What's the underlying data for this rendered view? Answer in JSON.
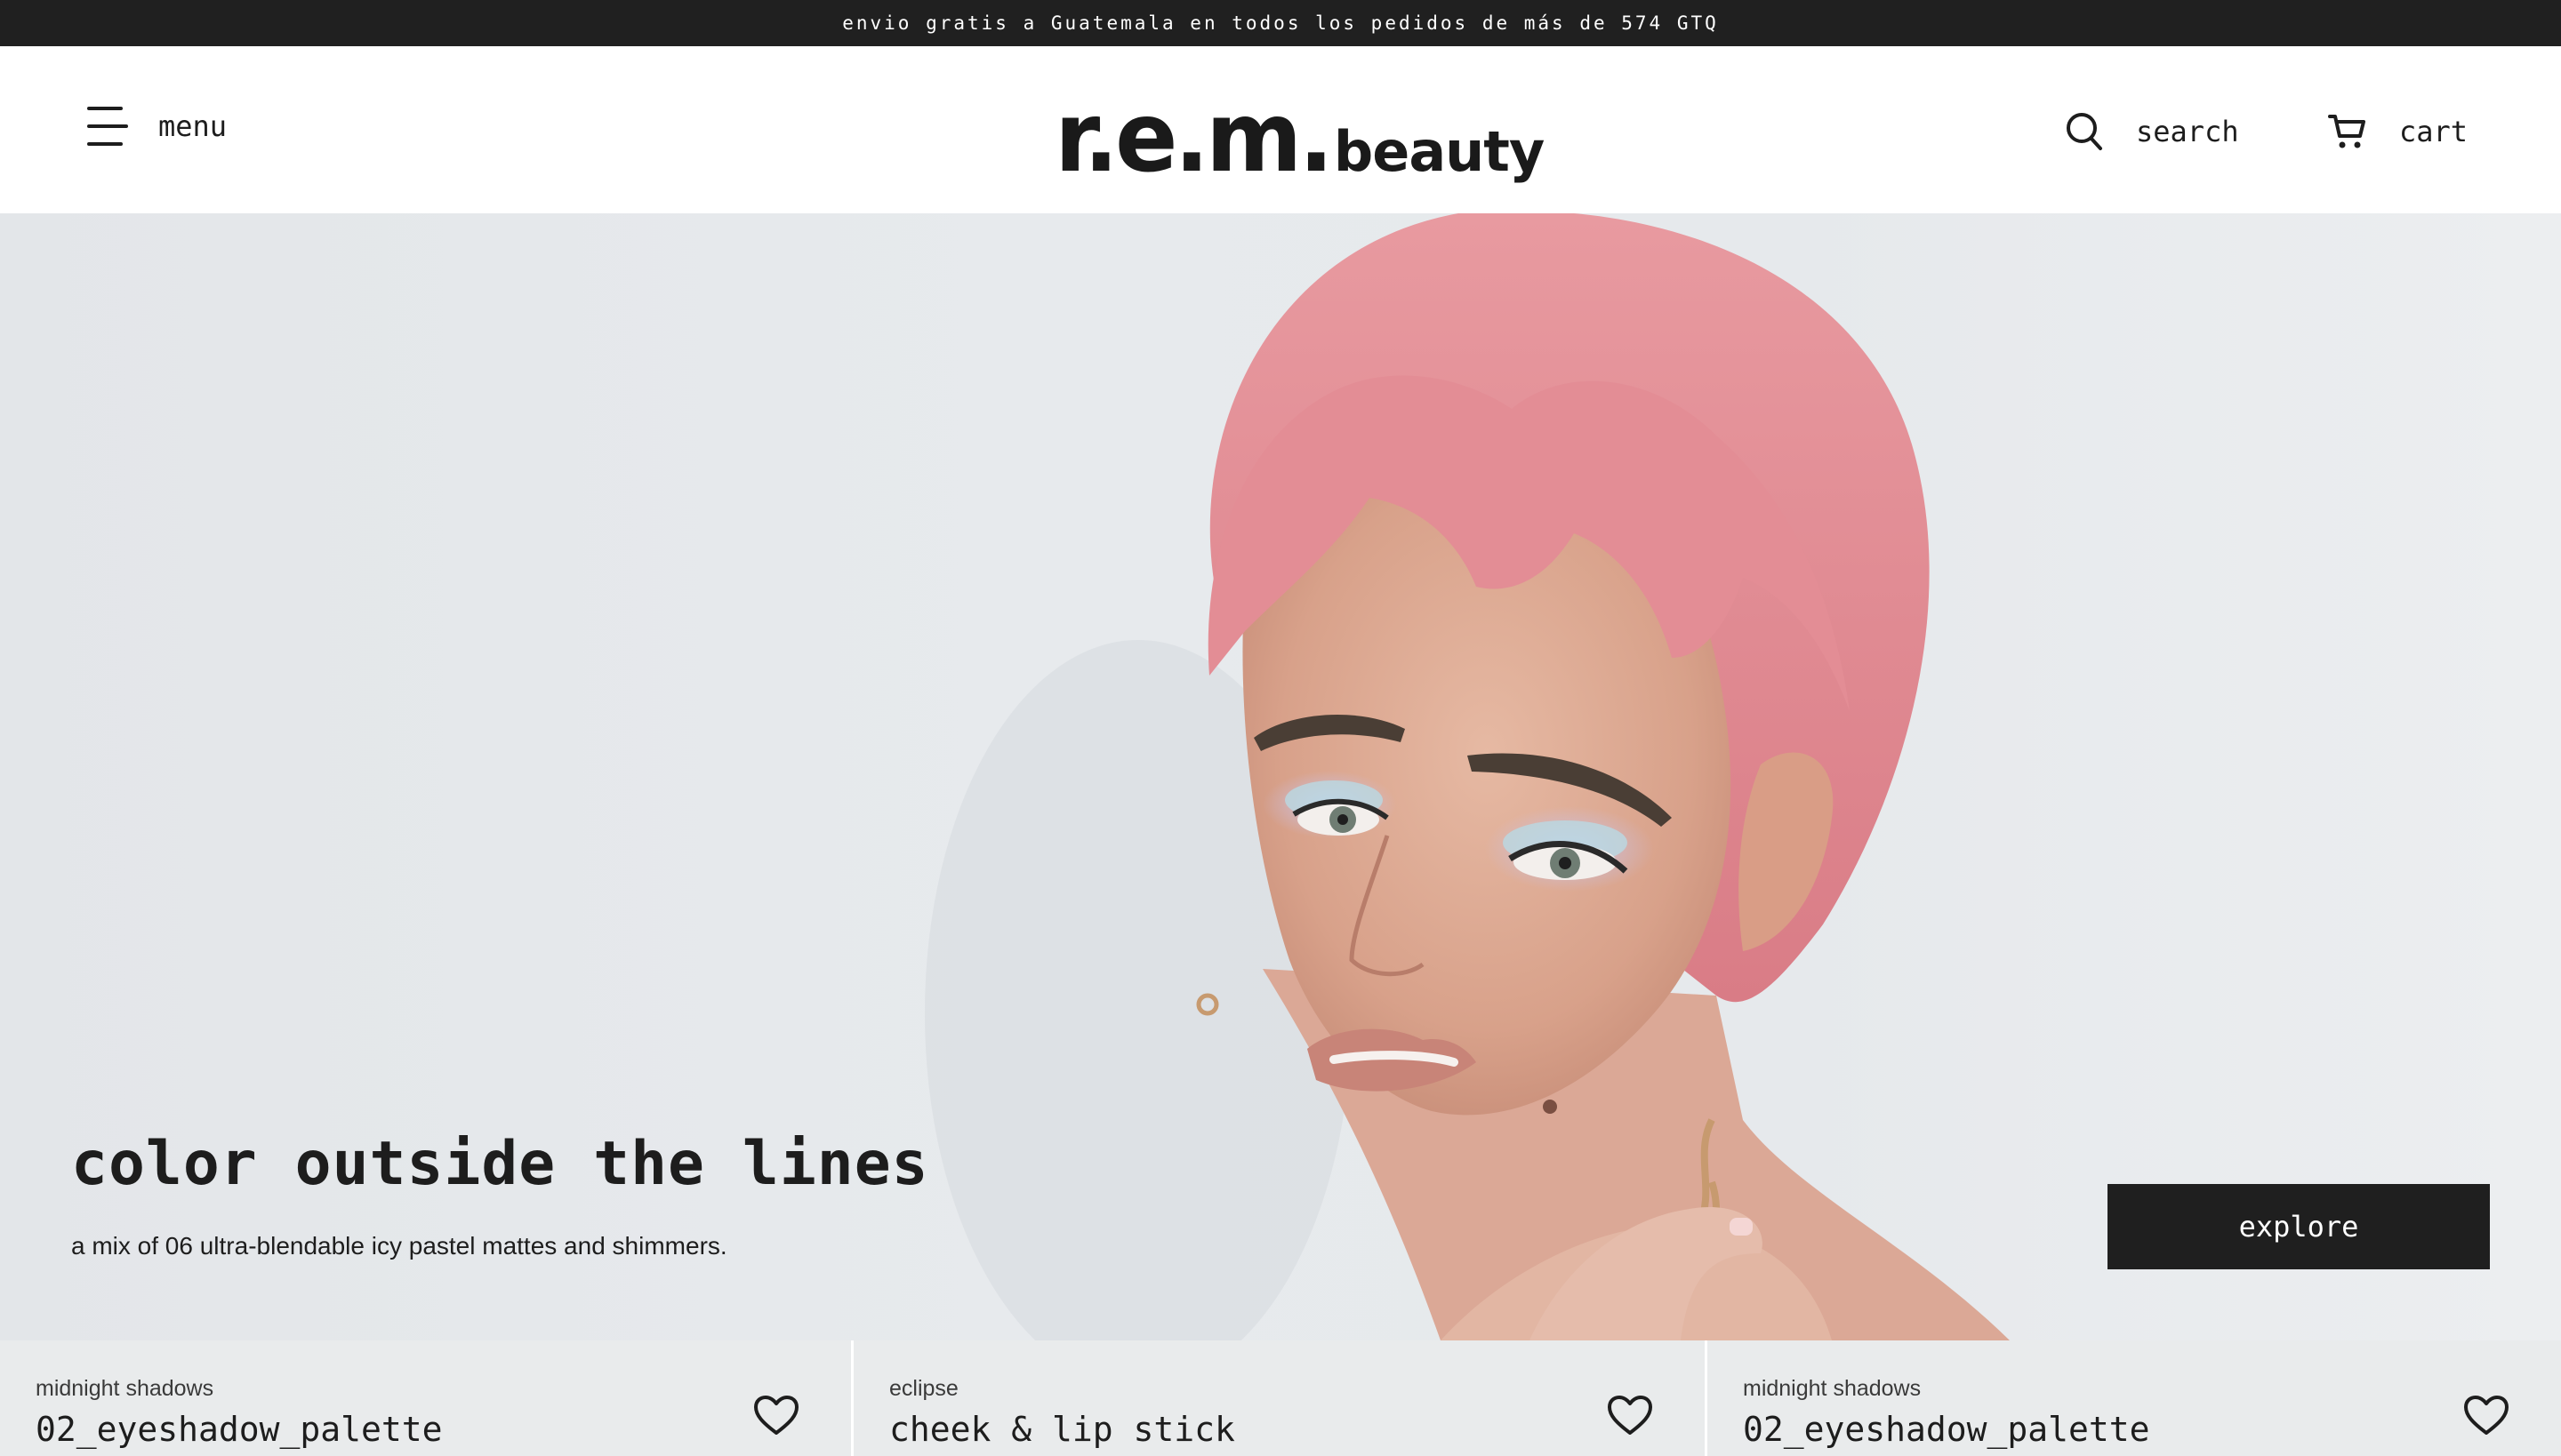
{
  "announcement": "envio gratis a Guatemala en todos los pedidos de más de 574 GTQ",
  "header": {
    "menu_label": "menu",
    "logo_main": "r.e.m.",
    "logo_sub": "beauty",
    "search_label": "search",
    "cart_label": "cart"
  },
  "icons": {
    "menu": "hamburger-icon",
    "search": "search-icon",
    "cart": "cart-icon",
    "wishlist": "heart-icon"
  },
  "hero": {
    "title": "color outside the lines",
    "subtitle": "a mix of 06 ultra-blendable icy pastel mattes and shimmers.",
    "button_label": "explore"
  },
  "products": [
    {
      "category": "midnight shadows",
      "name": "02_eyeshadow_palette"
    },
    {
      "category": "eclipse",
      "name": "cheek & lip stick"
    },
    {
      "category": "midnight shadows",
      "name": "02_eyeshadow_palette"
    }
  ],
  "colors": {
    "announcement_bg": "#202020",
    "button_bg": "#1f1f1f",
    "hero_bg": "#e6e9ec",
    "hair": "#e0848c",
    "card_bg": "#e9ebec"
  }
}
